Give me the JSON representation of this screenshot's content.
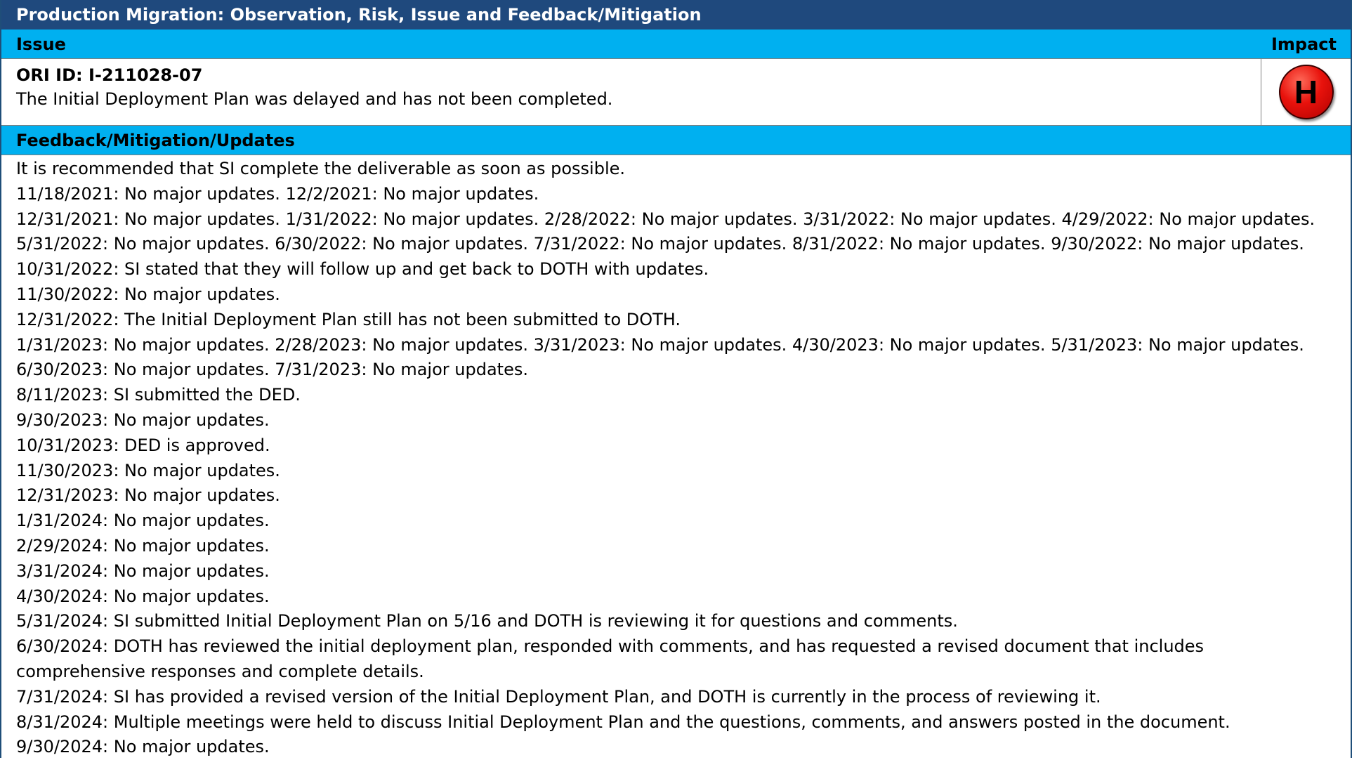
{
  "title": "Production Migration: Observation, Risk, Issue and Feedback/Mitigation",
  "issue_header": {
    "issue_label": "Issue",
    "impact_label": "Impact"
  },
  "issue": {
    "ori_id": "ORI ID: I-211028-07",
    "description": "The Initial Deployment Plan was delayed and has not been completed.",
    "impact_level": "H",
    "impact_color": "#e8120c"
  },
  "feedback_header": "Feedback/Mitigation/Updates",
  "updates": [
    "It is recommended that SI complete the deliverable as soon as possible.",
    "11/18/2021: No major updates. 12/2/2021: No major updates.",
    "12/31/2021: No major updates. 1/31/2022: No major updates. 2/28/2022: No major updates. 3/31/2022: No major updates. 4/29/2022: No major updates.",
    "5/31/2022: No major updates. 6/30/2022: No major updates. 7/31/2022: No major updates. 8/31/2022: No major updates. 9/30/2022: No major updates.",
    "10/31/2022: SI stated that they will follow up and get back to DOTH with updates.",
    "11/30/2022: No major updates.",
    "12/31/2022: The Initial Deployment Plan still has not been submitted to DOTH.",
    "1/31/2023: No major updates. 2/28/2023: No major updates. 3/31/2023: No major updates. 4/30/2023: No major updates. 5/31/2023: No major updates.",
    "6/30/2023: No major updates. 7/31/2023: No major updates.",
    "8/11/2023: SI submitted the DED.",
    "9/30/2023: No major updates.",
    "10/31/2023: DED is approved.",
    "11/30/2023: No major updates.",
    "12/31/2023: No major updates.",
    "1/31/2024: No major updates.",
    "2/29/2024: No major updates.",
    "3/31/2024: No major updates.",
    "4/30/2024: No major updates.",
    "5/31/2024: SI submitted Initial Deployment Plan on 5/16 and DOTH is reviewing it for questions and comments.",
    "6/30/2024: DOTH has reviewed the initial deployment plan, responded with comments, and has requested a revised document that includes comprehensive responses and complete details.",
    "7/31/2024: SI has provided a revised version of the Initial Deployment Plan, and DOTH is currently in the process of reviewing it.",
    "8/31/2024: Multiple meetings were held to discuss Initial Deployment Plan and the questions, comments, and answers posted in the document.",
    "9/30/2024: No major updates."
  ]
}
